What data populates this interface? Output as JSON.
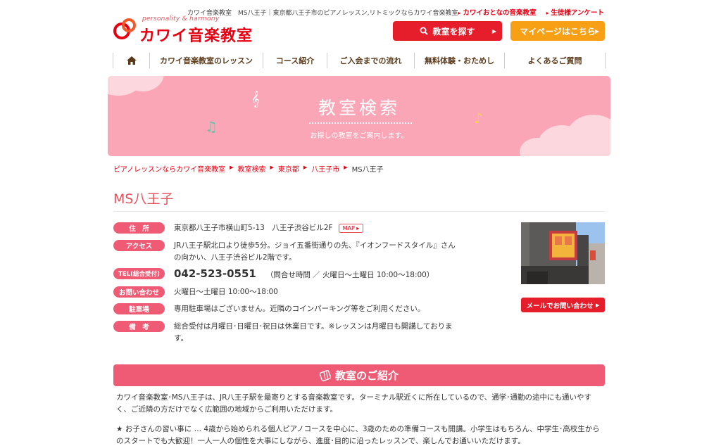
{
  "header": {
    "logo_tagline": "personality & harmony",
    "logo_name": "カワイ音楽教室",
    "site_description": "カワイ音楽教室　MS八王子｜東京都八王子市のピアノレッスン,リトミックならカワイ音楽教室",
    "link_adult": "カワイおとなの音楽教室",
    "link_survey": "生徒様アンケート",
    "search_button": "教室を探す",
    "mypage_button": "マイページはこちら"
  },
  "nav": {
    "home_icon": "home-icon",
    "items": [
      "カワイ音楽教室のレッスン",
      "コース紹介",
      "ご入会までの流れ",
      "無料体験・おためし",
      "よくあるご質問"
    ]
  },
  "banner": {
    "title": "教室検索",
    "subtitle": "お探しの教室をご案内します。"
  },
  "breadcrumb": [
    "ピアノレッスンならカワイ音楽教室",
    "教室検索",
    "東京都",
    "八王子市",
    "MS八王子"
  ],
  "classroom": {
    "name": "MS八王子",
    "rows": [
      {
        "label": "住　所",
        "value": "東京都八王子市横山町5-13　八王子渋谷ビル2F"
      },
      {
        "label": "アクセス",
        "value": "JR八王子駅北口より徒歩5分。ジョイ五番街通りの先、『イオンフードスタイル』さんの向かい、八王子渋谷ビル2階です。"
      },
      {
        "label": "TEL(総合受付)",
        "value": "042-523-0551"
      },
      {
        "label": "お問い合わせ",
        "value": "火曜日〜土曜日 10:00〜18:00"
      },
      {
        "label": "駐車場",
        "value": "専用駐車場はございません。近隣のコインパーキング等をご利用ください。"
      },
      {
        "label": "備　考",
        "value": "総合受付は月曜日･日曜日･祝日は休業日です。※レッスンは月曜日も開講しております。"
      }
    ],
    "map_button": "MAP",
    "tel_note": "（問合せ時間 ／ 火曜日〜土曜日 10:00〜18:00）",
    "mail_button": "メールでお問い合わせ"
  },
  "intro": {
    "heading": "教室のご紹介",
    "para1": "カワイ音楽教室･MS八王子は、JR八王子駅を最寄りとする音楽教室です。ターミナル駅近くに所在しているので、通学･通勤の途中にも通いやすく、ご近隣の方だけでなく広範囲の地域からご利用いただけます。",
    "para2": "★ お子さんの習い事に … 4歳から始められる個人ピアノコースを中心に、3歳のための準備コースも開講。小学生はもちろん、中学生･高校生からのスタートでも大歓迎！一人一人の個性を大事にしながら、進度･目的に沿ったレッスンで、楽しんでお通いいただけます。"
  },
  "colors": {
    "brand_red": "#e60012",
    "pink": "#ef5a74",
    "banner_pink": "#fba6b6",
    "orange": "#f8a015"
  }
}
